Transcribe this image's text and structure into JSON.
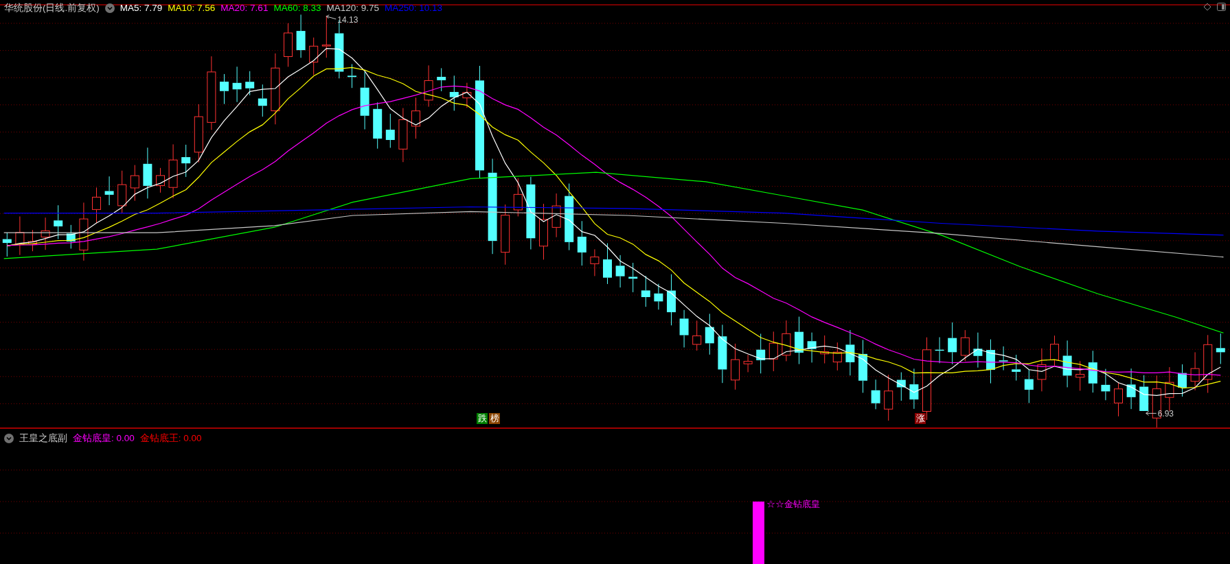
{
  "main_chart": {
    "title": "华统股份(日线.前复权)",
    "indicators": [
      {
        "label": "MA5: 7.79",
        "color": "#ffffff"
      },
      {
        "label": "MA10: 7.56",
        "color": "#ffff00"
      },
      {
        "label": "MA20: 7.61",
        "color": "#ff00ff"
      },
      {
        "label": "MA60: 8.33",
        "color": "#00ff00"
      },
      {
        "label": "MA120: 9.75",
        "color": "#c8c8c8"
      },
      {
        "label": "MA250: 10.13",
        "color": "#0000ff"
      }
    ],
    "high_label": "14.13",
    "low_label": "6.93",
    "signals": [
      {
        "text": "跌",
        "color": "#008000"
      },
      {
        "text": "榜",
        "color": "#8b4500"
      },
      {
        "text": "涨",
        "color": "#8b0000"
      }
    ]
  },
  "sub_chart": {
    "title": "王皇之底副",
    "indicators": [
      {
        "label": "金钻底皇: 0.00",
        "color": "#ff00ff"
      },
      {
        "label": "金钻底王: 0.00",
        "color": "#ff0000"
      }
    ],
    "signal_label": "☆☆金钻底皇"
  }
}
